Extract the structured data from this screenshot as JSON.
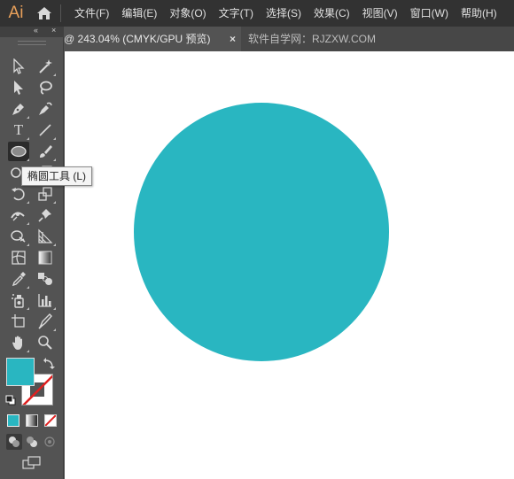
{
  "app": {
    "logo_text": "Ai"
  },
  "menu": [
    "文件(F)",
    "编辑(E)",
    "对象(O)",
    "文字(T)",
    "选择(S)",
    "效果(C)",
    "视图(V)",
    "窗口(W)",
    "帮助(H)"
  ],
  "tabs": {
    "active": "@ 243.04% (CMYK/GPU 预览)",
    "close_glyph": "×",
    "inactive": "软件自学网：RJZXW.COM"
  },
  "toolbar": {
    "collapse_glyph": "«",
    "close_glyph": "×",
    "type_tool_glyph": "T",
    "tooltip": "椭圆工具 (L)"
  },
  "colors": {
    "accent_shape": "#29B6C1",
    "canvas": "#FFFFFF",
    "panel": "#535353",
    "menubar": "#323232",
    "logo": "#E8A05A"
  }
}
